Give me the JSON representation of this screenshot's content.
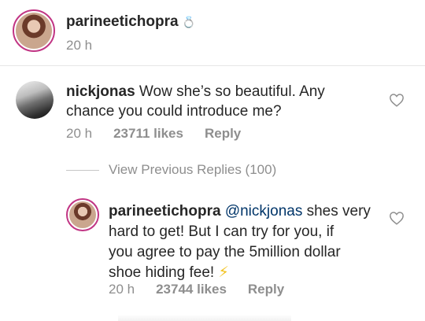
{
  "post": {
    "username": "parineetichopra",
    "emoji": "💍",
    "time": "20 h"
  },
  "comment": {
    "username": "nickjonas",
    "text": " Wow she’s so beautiful. Any",
    "text2": "chance you could introduce me?",
    "time": "20 h",
    "likes": "23711 likes",
    "reply": "Reply"
  },
  "view_previous": "View Previous Replies (100)",
  "reply": {
    "username": "parineetichopra",
    "mention": " @nickjonas",
    "line1_rest": " shes very",
    "line2": "hard to get! But I can try for you, if",
    "line3": "you agree to pay the 5million dollar",
    "line4": "shoe hiding fee! ",
    "emoji": "⚡",
    "time": "20 h",
    "likes": "23744 likes",
    "reply": "Reply"
  }
}
